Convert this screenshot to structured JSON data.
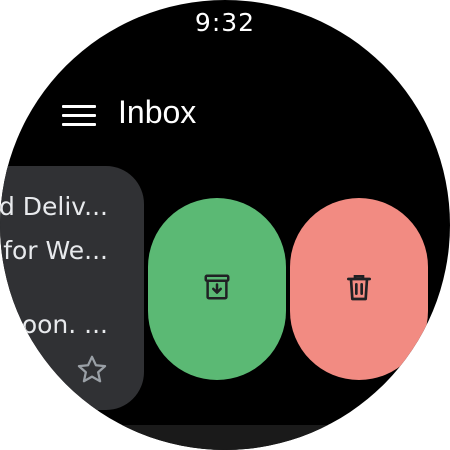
{
  "status": {
    "time": "9:32"
  },
  "header": {
    "title": "Inbox",
    "menu_icon": "menu-icon"
  },
  "email_card": {
    "lines": [
      "d Deliv...",
      "for We...",
      "oon. ..."
    ],
    "star_icon": "star-icon"
  },
  "actions": {
    "archive": {
      "icon": "archive-icon",
      "color": "#5bb974"
    },
    "delete": {
      "icon": "delete-icon",
      "color": "#f28b82"
    }
  },
  "colors": {
    "background": "#000000",
    "card": "#303134",
    "icon_dark": "#202124"
  }
}
